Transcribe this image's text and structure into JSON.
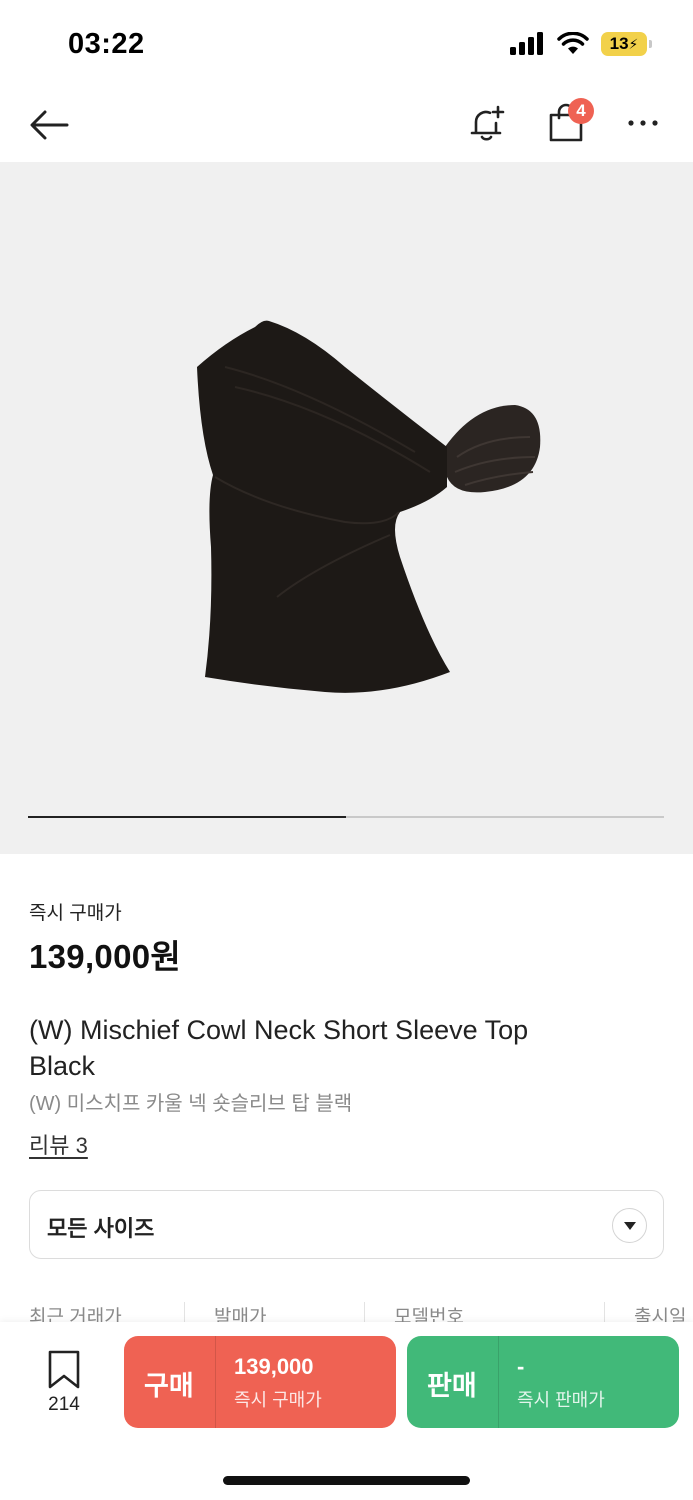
{
  "status_bar": {
    "time": "03:22",
    "battery": "13"
  },
  "header": {
    "cart_badge": "4"
  },
  "gallery": {
    "progress": 0.5
  },
  "product": {
    "price_label": "즉시 구매가",
    "price": "139,000원",
    "title": "(W) Mischief Cowl Neck Short Sleeve Top Black",
    "subtitle": "(W) 미스치프 카울 넥 숏슬리브 탑 블랙",
    "review_link": "리뷰 3"
  },
  "size_select": {
    "value": "모든 사이즈"
  },
  "info_row": [
    "최근 거래가",
    "발매가",
    "모델번호",
    "출시일"
  ],
  "bottom_bar": {
    "wish_count": "214",
    "buy": {
      "label": "구매",
      "value": "139,000",
      "sub": "즉시 구매가"
    },
    "sell": {
      "label": "판매",
      "value": "-",
      "sub": "즉시 판매가"
    }
  },
  "colors": {
    "buy": "#ef6253",
    "sell": "#41b979",
    "badge": "#ef6253",
    "battery": "#f2d14a"
  }
}
